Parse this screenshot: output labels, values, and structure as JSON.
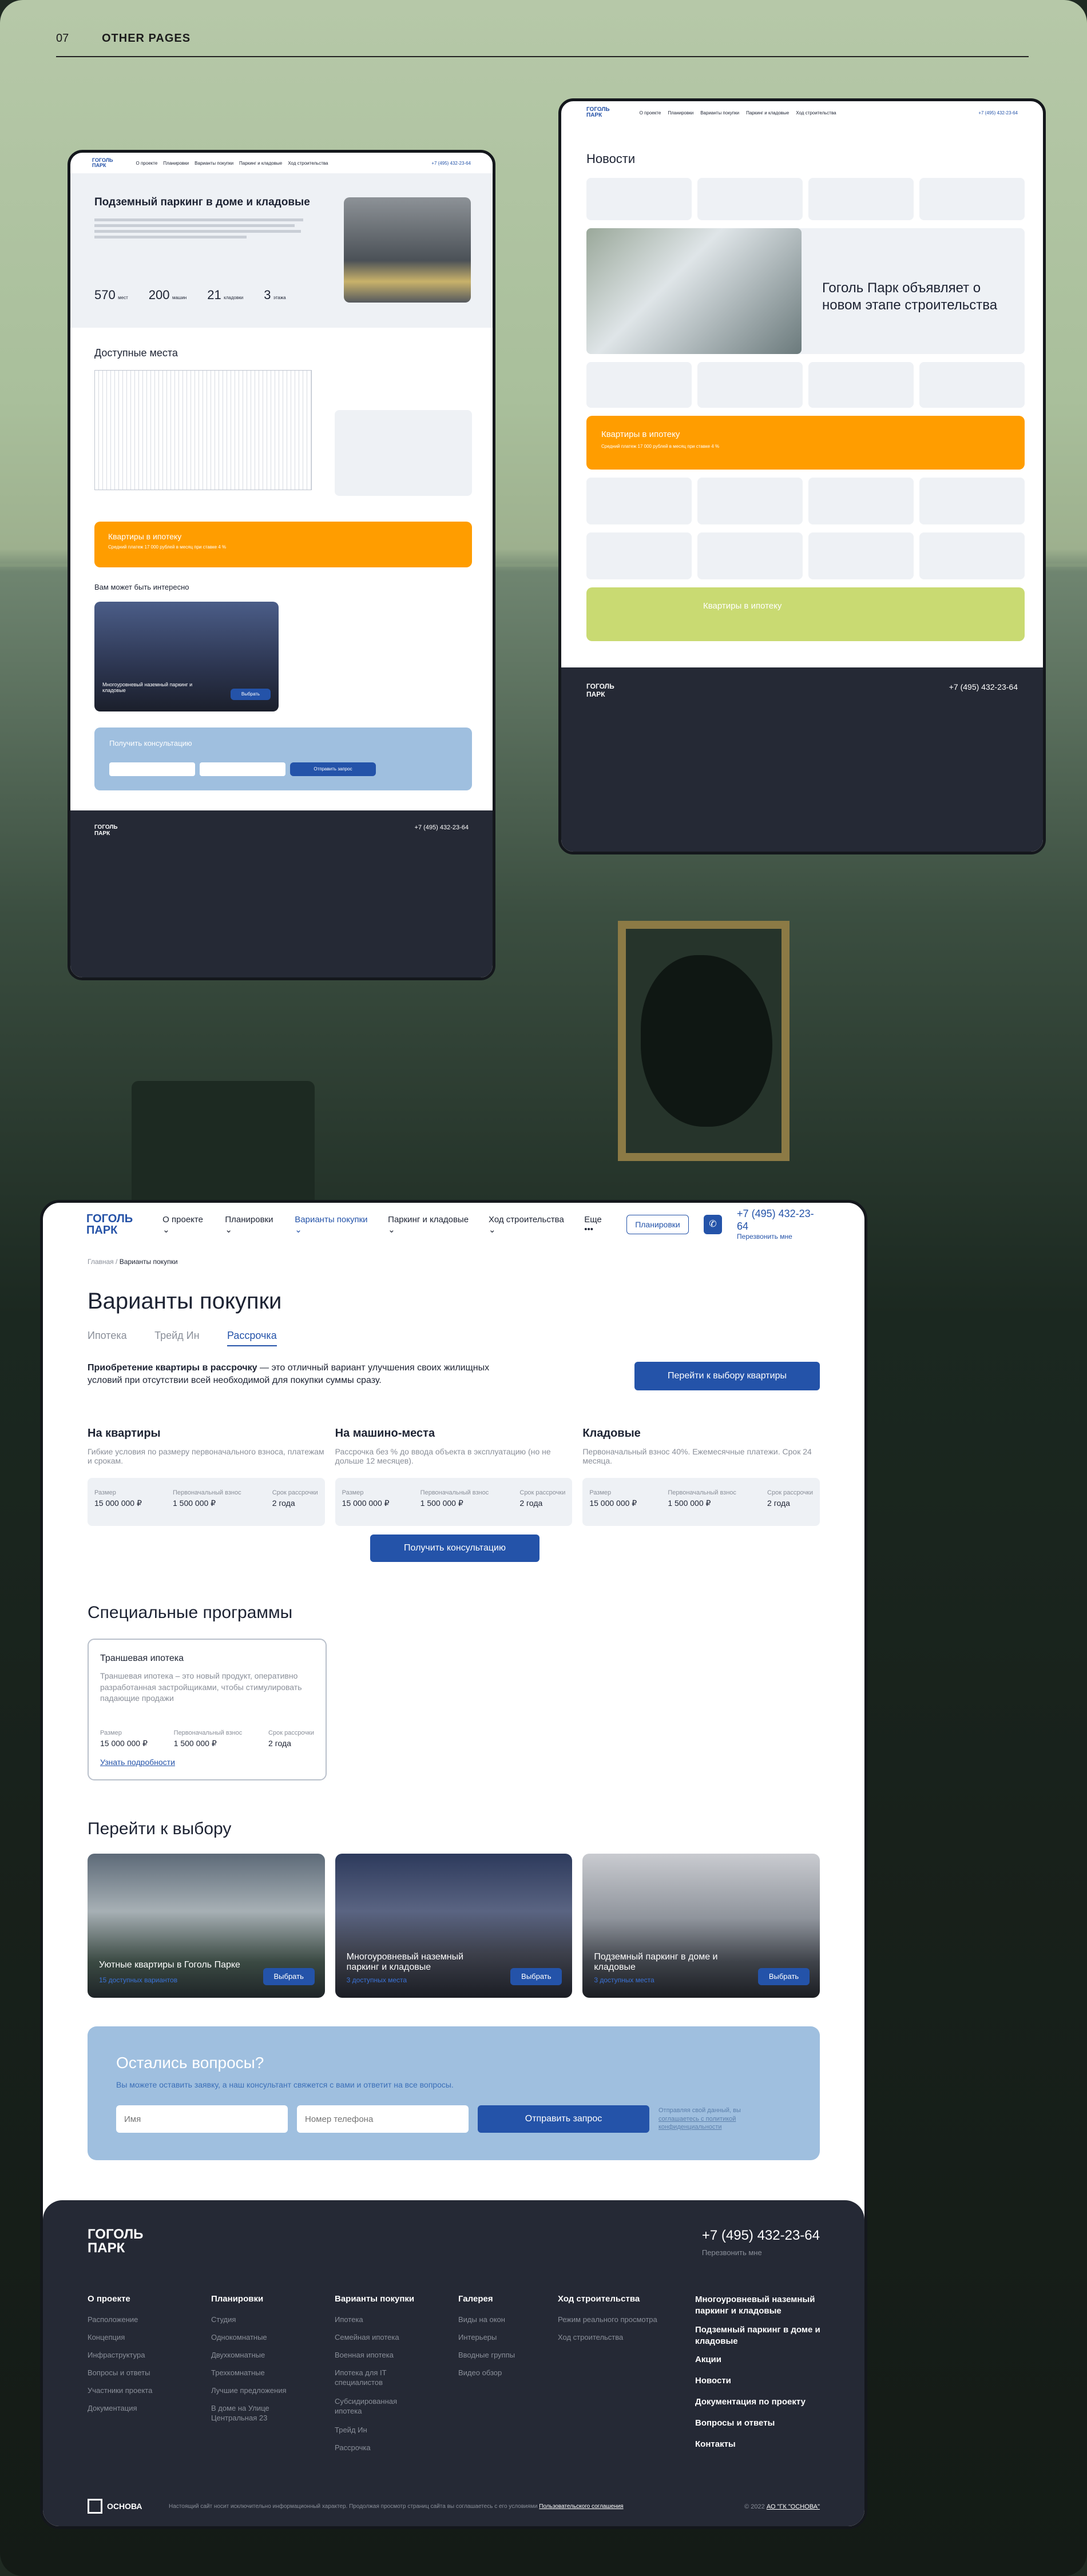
{
  "header": {
    "number": "07",
    "title": "OTHER PAGES"
  },
  "brand": {
    "logo_line1": "ГОГОЛЬ",
    "logo_line2": "ПАРК"
  },
  "nav": {
    "items": [
      "О проекте",
      "Планировки",
      "Варианты покупки",
      "Паркинг и кладовые",
      "Ход строительства",
      "Еще"
    ],
    "plans_button": "Планировки",
    "phone": "+7 (495) 432-23-64",
    "callback": "Перезвонить мне"
  },
  "main": {
    "breadcrumb_home": "Главная",
    "breadcrumb_current": "Варианты покупки",
    "title": "Варианты покупки",
    "tabs": [
      "Ипотека",
      "Трейд Ин",
      "Рассрочка"
    ],
    "intro_bold": "Приобретение квартиры в рассрочку",
    "intro_rest": " — это отличный вариант улучшения своих жилищных условий при отсутствии всей необходимой для покупки суммы сразу.",
    "choose_button": "Перейти к выбору квартиры",
    "options": [
      {
        "title": "На квартиры",
        "desc": "Гибкие условия по размеру первоначального взноса, платежам и срокам.",
        "size_label": "Размер",
        "size": "15 000 000 ₽",
        "down_label": "Первоначальный взнос",
        "down": "1 500 000 ₽",
        "term_label": "Срок рассрочки",
        "term": "2 года"
      },
      {
        "title": "На машино-места",
        "desc": "Рассрочка без % до ввода объекта в эксплуатацию (но не дольше 12 месяцев).",
        "size_label": "Размер",
        "size": "15 000 000 ₽",
        "down_label": "Первоначальный взнос",
        "down": "1 500 000 ₽",
        "term_label": "Срок рассрочки",
        "term": "2 года"
      },
      {
        "title": "Кладовые",
        "desc": "Первоначальный взнос 40%. Ежемесячные платежи. Срок 24 месяца.",
        "size_label": "Размер",
        "size": "15 000 000 ₽",
        "down_label": "Первоначальный взнос",
        "down": "1 500 000 ₽",
        "term_label": "Срок рассрочки",
        "term": "2 года"
      }
    ],
    "consult_button": "Получить консультацию",
    "special_title": "Специальные программы",
    "special": {
      "title": "Траншевая ипотека",
      "desc": "Траншевая ипотека – это новый продукт, оперативно разработанная застройщиками, чтобы стимулировать падающие продажи",
      "size_label": "Размер",
      "size": "15 000 000 ₽",
      "down_label": "Первоначальный взнос",
      "down": "1 500 000 ₽",
      "term_label": "Срок рассрочки",
      "term": "2 года",
      "link": "Узнать подробности"
    },
    "choose_title": "Перейти к выбору",
    "choose": [
      {
        "title": "Уютные квартиры в Гоголь Парке",
        "sub": "15 доступных вариантов",
        "btn": "Выбрать"
      },
      {
        "title": "Многоуровневый наземный паркинг и кладовые",
        "sub": "3 доступных места",
        "btn": "Выбрать"
      },
      {
        "title": "Подземный паркинг в доме и кладовые",
        "sub": "3 доступных места",
        "btn": "Выбрать"
      }
    ],
    "questions": {
      "title": "Остались вопросы?",
      "desc": "Вы можете оставить заявку, а наш консультант свяжется с вами и ответит на все вопросы.",
      "name_ph": "Имя",
      "phone_ph": "Номер телефона",
      "send": "Отправить запрос",
      "consent1": "Отправляя свой данный, вы ",
      "consent_link": "соглашаетесь с политикой конфиденциальности"
    }
  },
  "footer": {
    "phone": "+7 (495) 432-23-64",
    "callback": "Перезвонить мне",
    "cols": [
      {
        "title": "О проекте",
        "items": [
          "Расположение",
          "Концепция",
          "Инфраструктура",
          "Вопросы и ответы",
          "Участники проекта",
          "Документация"
        ]
      },
      {
        "title": "Планировки",
        "items": [
          "Студия",
          "Однокомнатные",
          "Двухкомнатные",
          "Трехкомнатные",
          "Лучшие предложения",
          "В доме на Улице Центральная 23"
        ]
      },
      {
        "title": "Варианты покупки",
        "items": [
          "Ипотека",
          "Семейная ипотека",
          "Военная ипотека",
          "Ипотека для IT специалистов",
          "Субсидированная ипотека",
          "Трейд Ин",
          "Рассрочка"
        ]
      },
      {
        "title": "Галерея",
        "items": [
          "Виды на окон",
          "Интерьеры",
          "Вводные группы",
          "Видео обзор"
        ]
      },
      {
        "title": "Ход строительства",
        "items": [
          "Режим реального просмотра",
          "Ход строительства"
        ]
      }
    ],
    "right": [
      "Многоуровневый наземный паркинг и кладовые",
      "Подземный паркинг в доме и кладовые",
      "Акции",
      "Новости",
      "Документация по проекту",
      "Вопросы и ответы",
      "Контакты"
    ],
    "osnova": "ОСНОВА",
    "legal": "Настоящий сайт носит исключительно информационный характер. Продолжая просмотр страниц сайта вы соглашаетесь с его условиями",
    "legal_link": "Пользовательского соглашения",
    "copy": "© 2022 ",
    "copy_link": "АО \"ГК \"ОСНОВА\""
  },
  "d1": {
    "title": "Подземный паркинг в доме и кладовые",
    "stats": [
      {
        "v": "570",
        "u": "мест"
      },
      {
        "v": "200",
        "u": "машин"
      },
      {
        "v": "21",
        "u": "кладовки"
      },
      {
        "v": "3",
        "u": "этажа"
      }
    ],
    "avail": "Доступные места",
    "mortgage": "Квартиры в ипотеку",
    "mortgage_sub": "Средний платеж 17 000 рублей в месяц при ставке 4 %",
    "interest": "Вам может быть интересно",
    "card_title": "Многоуровневый наземный паркинг и кладовые",
    "card_btn": "Выбрать",
    "consult": "Получить консультацию",
    "send": "Отправить запрос"
  },
  "d2": {
    "title": "Новости",
    "feature": "Гоголь Парк объявляет о новом этапе строительства",
    "mortgage": "Квартиры в ипотеку",
    "mortgage_sub": "Средний платеж 17 000 рублей в месяц при ставке 4 %",
    "mortgage2": "Квартиры в ипотеку"
  }
}
